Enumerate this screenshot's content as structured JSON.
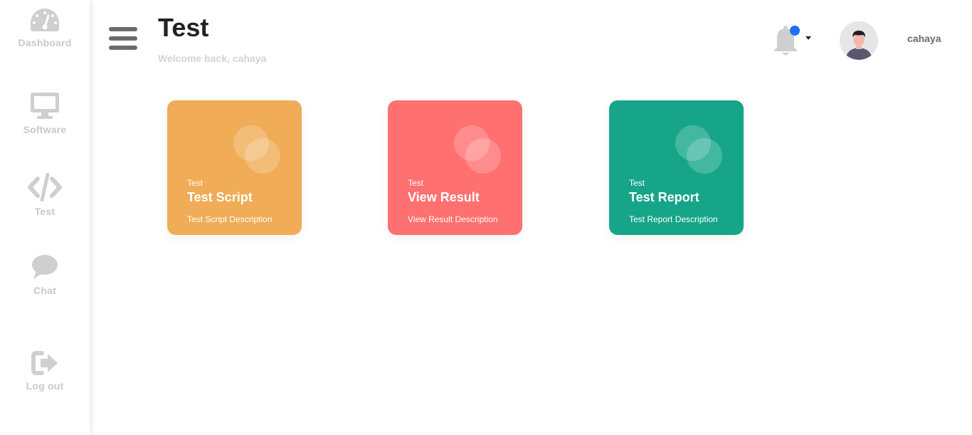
{
  "sidebar": {
    "items": [
      {
        "label": "Dashboard",
        "icon": "dashboard-gauge-icon"
      },
      {
        "label": "Software",
        "icon": "monitor-icon"
      },
      {
        "label": "Test",
        "icon": "code-icon"
      },
      {
        "label": "Chat",
        "icon": "chat-bubble-icon"
      },
      {
        "label": "Log out",
        "icon": "logout-icon"
      }
    ]
  },
  "header": {
    "title": "Test",
    "welcome": "Welcome back, cahaya",
    "username": "cahaya",
    "notification_dot_color": "#1e6ff5"
  },
  "cards": [
    {
      "kicker": "Test",
      "title": "Test Script",
      "description": "Test Script Description",
      "color": "#f0ac56"
    },
    {
      "kicker": "Test",
      "title": "View Result",
      "description": "View Result Description",
      "color": "#ff7070"
    },
    {
      "kicker": "Test",
      "title": "Test Report",
      "description": "Test Report Description",
      "color": "#16a589"
    }
  ]
}
